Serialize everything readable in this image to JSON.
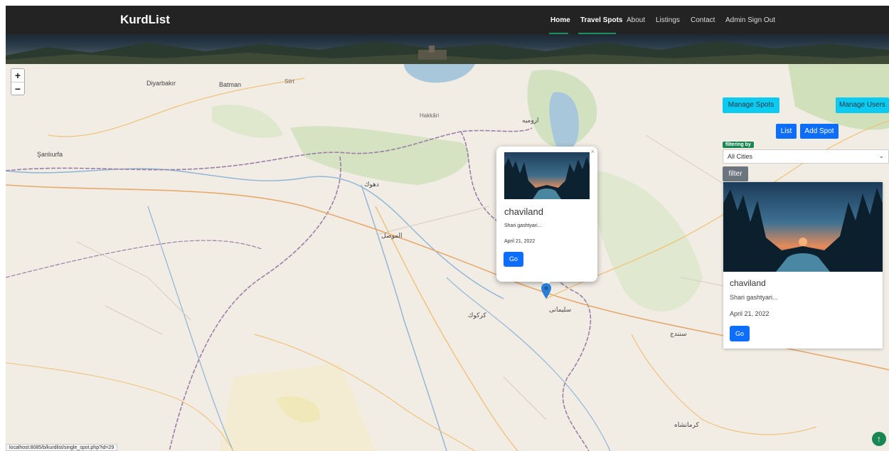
{
  "navbar": {
    "brand": "KurdList",
    "links": [
      "Home",
      "Travel Spots",
      "About",
      "Listings",
      "Contact",
      "Admin Sign Out"
    ]
  },
  "map_labels": {
    "diyarbakir": "Diyarbakır",
    "batman": "Batman",
    "siirt": "Siirt",
    "sanliurfa": "Şanlıurfa",
    "batman_ar": "Batman",
    "duhok": "دهوك",
    "mosul": "الموصل",
    "kirkuk": "كركوك",
    "sulaymaniyah": "سليمانى",
    "hakkari": "Hakkâri",
    "urmia": "ارومیه",
    "sanandaj": "سنندج",
    "kermanshah": "كرمانشاه"
  },
  "zoom": {
    "plus": "+",
    "minus": "−"
  },
  "popup": {
    "close": "×",
    "title": "chaviland",
    "description": "Shari gashtyari...",
    "date": "April 21, 2022",
    "go": "Go"
  },
  "panel": {
    "manage_spots": "Manage Spots",
    "manage_users": "Manage Users",
    "list": "List",
    "add_spot": "Add Spot",
    "filter_badge": "filtering by",
    "city_select": "All Cities",
    "filter_button": "filter"
  },
  "card": {
    "title": "chaviland",
    "description": "Shari gashtyari...",
    "date": "April 21, 2022",
    "go": "Go"
  },
  "status_url": "localhost:8085/b/kurdlist/single_spot.php?id=29",
  "scroll_top_icon": "↑",
  "colors": {
    "navbar": "#232323",
    "primary": "#0d6efd",
    "info": "#0dcaf0",
    "success": "#198754",
    "secondary": "#6c757d"
  },
  "icons": [
    "map-marker-icon",
    "arrow-up-icon",
    "chevron-down-icon",
    "close-icon"
  ]
}
